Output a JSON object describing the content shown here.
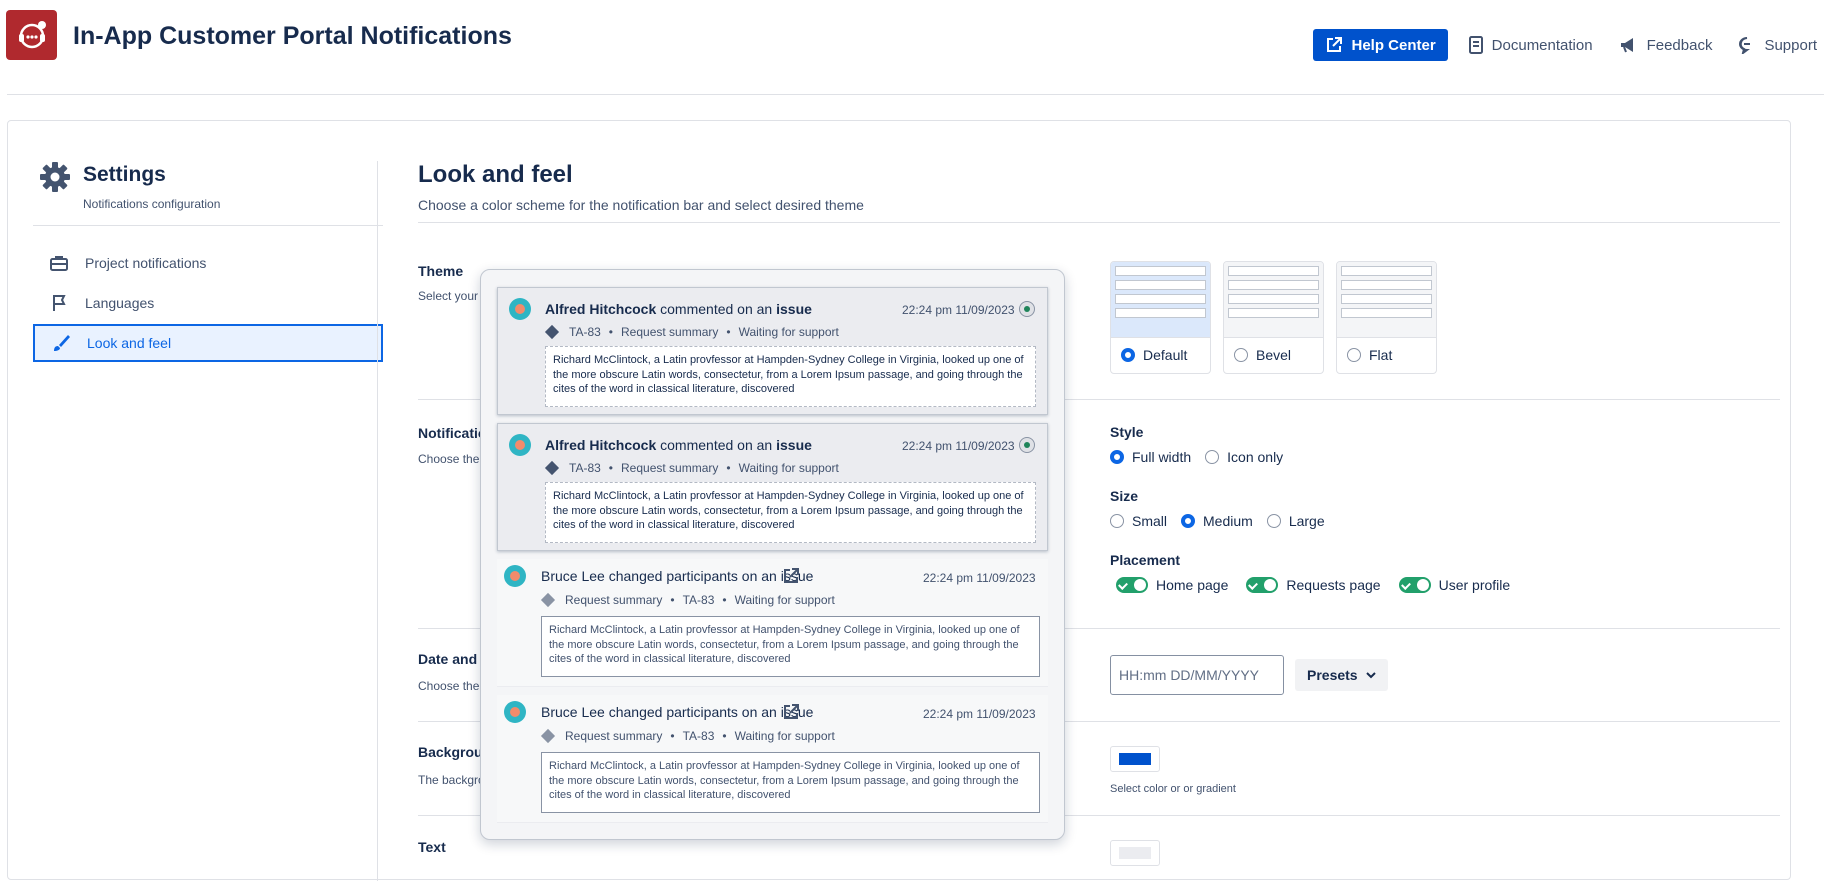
{
  "header": {
    "app_title": "In-App Customer Portal Notifications",
    "nav": [
      {
        "label": "Help Center",
        "icon": "external-link-icon"
      },
      {
        "label": "Documentation",
        "icon": "document-icon"
      },
      {
        "label": "Feedback",
        "icon": "megaphone-icon"
      },
      {
        "label": "Support",
        "icon": "chat-icon"
      }
    ]
  },
  "sidebar": {
    "title": "Settings",
    "subtitle": "Notifications configuration",
    "items": [
      {
        "label": "Project notifications",
        "icon": "briefcase-icon"
      },
      {
        "label": "Languages",
        "icon": "flag-icon"
      },
      {
        "label": "Look and feel",
        "icon": "brush-icon",
        "active": true
      }
    ]
  },
  "main": {
    "title": "Look and feel",
    "subtitle": "Choose a color scheme for the notification bar and select desired theme",
    "sections": {
      "theme": {
        "title": "Theme",
        "sub": "Select your"
      },
      "notification": {
        "title": "Notificatio",
        "sub": "Choose the"
      },
      "date": {
        "title": "Date and t",
        "sub": "Choose the"
      },
      "background": {
        "title": "Backgroun",
        "sub": "The backgro"
      },
      "text": {
        "title": "Text"
      }
    },
    "themes": [
      {
        "label": "Default",
        "selected": true
      },
      {
        "label": "Bevel",
        "selected": false
      },
      {
        "label": "Flat",
        "selected": false
      }
    ],
    "style": {
      "label": "Style",
      "options": [
        "Full width",
        "Icon only"
      ],
      "selected": "Full width"
    },
    "size": {
      "label": "Size",
      "options": [
        "Small",
        "Medium",
        "Large"
      ],
      "selected": "Medium"
    },
    "placement": {
      "label": "Placement",
      "options": [
        "Home page",
        "Requests page",
        "User profile"
      ]
    },
    "date_format": {
      "placeholder": "HH:mm DD/MM/YYYY",
      "presets_label": "Presets"
    },
    "background_color": {
      "value": "#0052cc",
      "hint": "Select color or or gradient"
    }
  },
  "popup": {
    "notifications": [
      {
        "state": "unread",
        "user": "Alfred Hitchcock",
        "action": "commented on an",
        "object": "issue",
        "time": "22:24 pm 11/09/2023",
        "meta": [
          "TA-83",
          "Request summary",
          "Waiting for support"
        ],
        "body": "Richard McClintock, a Latin provfessor at Hampden-Sydney College in Virginia, looked up one of the more obscure Latin words, consectetur, from a Lorem Ipsum passage, and going through the cites of the word in classical literature, discovered"
      },
      {
        "state": "unread",
        "user": "Alfred Hitchcock",
        "action": "commented on an",
        "object": "issue",
        "time": "22:24 pm 11/09/2023",
        "meta": [
          "TA-83",
          "Request summary",
          "Waiting for support"
        ],
        "body": "Richard McClintock, a Latin provfessor at Hampden-Sydney College in Virginia, looked up one of the more obscure Latin words, consectetur, from a Lorem Ipsum passage, and going through the cites of the word in classical literature, discovered"
      },
      {
        "state": "read",
        "headline": "Bruce Lee changed participants on an issue",
        "time": "22:24 pm 11/09/2023",
        "meta": [
          "Request summary",
          "TA-83",
          "Waiting for support"
        ],
        "body": "Richard McClintock, a Latin provfessor at Hampden-Sydney College in Virginia, looked up one of the more obscure Latin words, consectetur, from a Lorem Ipsum passage, and going through the cites of the word in classical literature, discovered"
      },
      {
        "state": "read",
        "headline": "Bruce Lee changed participants on an issue",
        "time": "22:24 pm 11/09/2023",
        "meta": [
          "Request summary",
          "TA-83",
          "Waiting for support"
        ],
        "body": "Richard McClintock, a Latin provfessor at Hampden-Sydney College in Virginia, looked up one of the more obscure Latin words, consectetur, from a Lorem Ipsum passage, and going through the cites of the word in classical literature, discovered"
      }
    ]
  }
}
